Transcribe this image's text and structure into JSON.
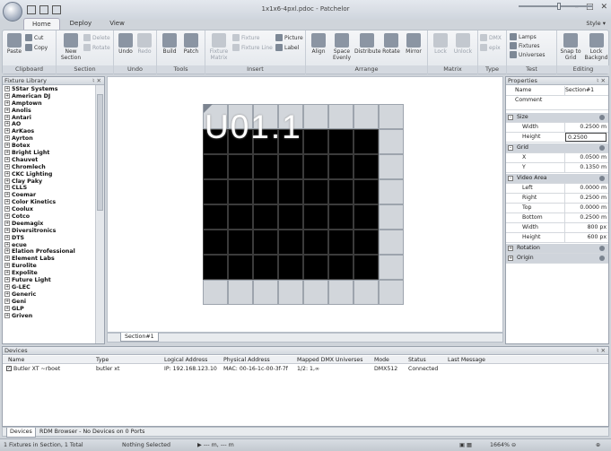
{
  "window": {
    "title": "1x1x6-4pxl.pdoc - Patchelor",
    "style_menu": "Style"
  },
  "tabs": [
    "Home",
    "Deploy",
    "View"
  ],
  "ribbon": {
    "clipboard": {
      "label": "Clipboard",
      "paste": "Paste",
      "cut": "Cut",
      "copy": "Copy"
    },
    "section": {
      "label": "Section",
      "delete": "Delete",
      "rotate": "Rotate",
      "new_section": "New Section"
    },
    "undo": {
      "label": "Undo",
      "undo": "Undo",
      "redo": "Redo"
    },
    "tools": {
      "label": "Tools",
      "build": "Build",
      "patch": "Patch"
    },
    "insert": {
      "label": "Insert",
      "fixture_matrix": "Fixture Matrix",
      "fixture": "Fixture",
      "fixture_line": "Fixture Line",
      "picture": "Picture",
      "label_btn": "Label"
    },
    "arrange": {
      "label": "Arrange",
      "align": "Align",
      "space_evenly": "Space Evenly",
      "distribute": "Distribute",
      "rotate": "Rotate",
      "mirror": "Mirror"
    },
    "matrix": {
      "label": "Matrix",
      "lock": "Lock",
      "unlock": "Unlock"
    },
    "type": {
      "label": "Type",
      "dmx": "DMX",
      "epix": "epix"
    },
    "test": {
      "label": "Test",
      "lamps": "Lamps",
      "fixtures": "Fixtures",
      "universes": "Universes"
    },
    "editing": {
      "label": "Editing",
      "snap_to_grid": "Snap to Grid",
      "lock_background": "Lock Backgnd"
    }
  },
  "fixture_library": {
    "title": "Fixture Library",
    "items": [
      "5Star Systems",
      "American DJ",
      "Amptown",
      "Anolis",
      "Antari",
      "AO",
      "ArKaos",
      "Ayrton",
      "Botex",
      "Bright Light",
      "Chauvet",
      "Chromlech",
      "CKC Lighting",
      "Clay Paky",
      "CLLS",
      "Coemar",
      "Color Kinetics",
      "Coolux",
      "Cotco",
      "Deemagix",
      "Diversitronics",
      "DTS",
      "ecue",
      "Elation Professional",
      "Element Labs",
      "Eurolite",
      "Expolite",
      "Future Light",
      "G-LEC",
      "Generic",
      "Geni",
      "GLP",
      "Griven"
    ]
  },
  "canvas": {
    "section_name": "U01.1",
    "section_tab": "Section#1"
  },
  "properties": {
    "title": "Properties",
    "name_label": "Name",
    "name_value": "Section#1",
    "comment_label": "Comment",
    "size": {
      "label": "Size",
      "width_label": "Width",
      "width_value": "0.2500 m",
      "height_label": "Height",
      "height_value": "0.2500"
    },
    "grid": {
      "label": "Grid",
      "x_label": "X",
      "x_value": "0.0500 m",
      "y_label": "Y",
      "y_value": "0.1350 m"
    },
    "video_area": {
      "label": "Video Area",
      "left_label": "Left",
      "left_value": "0.0000 m",
      "right_label": "Right",
      "right_value": "0.2500 m",
      "top_label": "Top",
      "top_value": "0.0000 m",
      "bottom_label": "Bottom",
      "bottom_value": "0.2500 m",
      "width_label": "Width",
      "width_value": "800 px",
      "height_label": "Height",
      "height_value": "600 px"
    },
    "rotation_label": "Rotation",
    "origin_label": "Origin"
  },
  "devices": {
    "title": "Devices",
    "columns": [
      "Name",
      "Type",
      "Logical Address",
      "Physical Address",
      "Mapped DMX Universes",
      "Mode",
      "Status",
      "Last Message"
    ],
    "rows": [
      {
        "name": "Butler XT ~rboet",
        "type": "butler xt",
        "logical": "IP: 192.168.123.10",
        "physical": "MAC: 00-16-1c-00-3f-7f",
        "universes": "1/2: 1,∞",
        "mode": "DMX512",
        "status": "Connected",
        "last_message": ""
      }
    ],
    "tabs": [
      "Devices",
      "RDM Browser - No Devices on 0 Ports"
    ]
  },
  "status_bar": {
    "fixtures_info": "1 Fixtures in Section, 1 Total",
    "selection": "Nothing Selected",
    "coords": "--- m, --- m",
    "zoom": "1664%",
    "zoom_level": 0.55
  }
}
